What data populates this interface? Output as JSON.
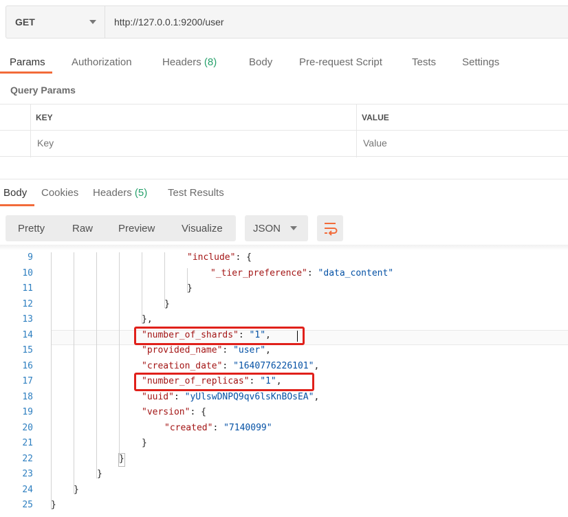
{
  "request": {
    "method": "GET",
    "url": "http://127.0.0.1:9200/user"
  },
  "request_tabs": {
    "params": "Params",
    "authorization": "Authorization",
    "headers": "Headers",
    "headers_count": "(8)",
    "body": "Body",
    "prerequest": "Pre-request Script",
    "tests": "Tests",
    "settings": "Settings"
  },
  "query_params": {
    "title": "Query Params",
    "key_header": "KEY",
    "value_header": "VALUE",
    "key_placeholder": "Key",
    "value_placeholder": "Value"
  },
  "response_tabs": {
    "body": "Body",
    "cookies": "Cookies",
    "headers": "Headers",
    "headers_count": "(5)",
    "test_results": "Test Results"
  },
  "view_modes": {
    "pretty": "Pretty",
    "raw": "Raw",
    "preview": "Preview",
    "visualize": "Visualize",
    "format": "JSON"
  },
  "icons": {
    "method_dropdown": "chevron-down-icon",
    "format_dropdown": "chevron-down-icon",
    "wrap": "wrap-lines-icon"
  },
  "colors": {
    "accent": "#f26b3a",
    "count": "#26a06b",
    "json_key": "#a31515",
    "json_string": "#0451a5",
    "line_number": "#2e7fc0",
    "highlight_box": "#e0201a"
  },
  "code_lines": [
    {
      "num": "9",
      "open": "\"include\": {"
    },
    {
      "num": "10",
      "key": "\"_tier_preference\"",
      "sep": ": ",
      "val": "\"data_content\"",
      "tail": ""
    },
    {
      "num": "11",
      "text": "}"
    },
    {
      "num": "12",
      "text": "}"
    },
    {
      "num": "13",
      "text": "},"
    },
    {
      "num": "14",
      "key": "\"number_of_shards\"",
      "sep": ": ",
      "val": "\"1\"",
      "tail": ","
    },
    {
      "num": "15",
      "key": "\"provided_name\"",
      "sep": ": ",
      "val": "\"user\"",
      "tail": ","
    },
    {
      "num": "16",
      "key": "\"creation_date\"",
      "sep": ": ",
      "val": "\"1640776226101\"",
      "tail": ","
    },
    {
      "num": "17",
      "key": "\"number_of_replicas\"",
      "sep": ": ",
      "val": "\"1\"",
      "tail": ","
    },
    {
      "num": "18",
      "key": "\"uuid\"",
      "sep": ": ",
      "val": "\"yUlswDNPQ9qv6lsKnBOsEA\"",
      "tail": ","
    },
    {
      "num": "19",
      "open": "\"version\": {"
    },
    {
      "num": "20",
      "key": "\"created\"",
      "sep": ": ",
      "val": "\"7140099\"",
      "tail": ""
    },
    {
      "num": "21",
      "text": "}"
    },
    {
      "num": "22",
      "text": "}"
    },
    {
      "num": "23",
      "text": "}"
    },
    {
      "num": "24",
      "text": "}"
    },
    {
      "num": "25",
      "text": "}"
    }
  ]
}
